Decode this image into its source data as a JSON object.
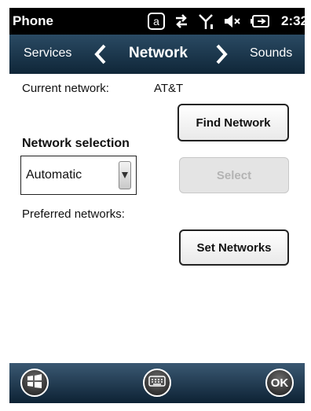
{
  "status_bar": {
    "app_title": "Phone",
    "time": "2:32",
    "icons": [
      "at-sign-icon",
      "data-transfer-icon",
      "signal-strength-icon",
      "volume-muted-icon",
      "battery-charging-icon"
    ]
  },
  "tab_bar": {
    "prev_label": "Services",
    "current_label": "Network",
    "next_label": "Sounds"
  },
  "network": {
    "current_network_label": "Current network:",
    "current_network_value": "AT&T",
    "find_network_button": "Find Network",
    "selection_heading": "Network selection",
    "selection_value": "Automatic",
    "select_button": "Select",
    "select_button_enabled": false,
    "preferred_label": "Preferred networks:",
    "set_networks_button": "Set Networks"
  },
  "bottom_bar": {
    "ok_label": "OK",
    "icons": [
      "windows-start-icon",
      "keyboard-icon"
    ]
  },
  "colors": {
    "header_gradient_top": "#2a4a63",
    "header_gradient_bottom": "#0f2638",
    "disabled_button_bg": "#e4e4e4",
    "disabled_button_text": "#b3b3b3"
  }
}
